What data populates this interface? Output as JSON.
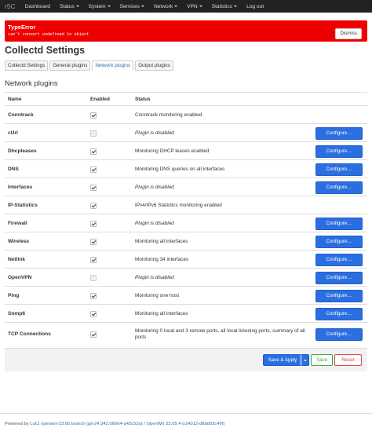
{
  "navbar": {
    "brand": "r5C",
    "items": [
      {
        "label": "Dashboard",
        "dropdown": false
      },
      {
        "label": "Status",
        "dropdown": true
      },
      {
        "label": "System",
        "dropdown": true
      },
      {
        "label": "Services",
        "dropdown": true
      },
      {
        "label": "Network",
        "dropdown": true
      },
      {
        "label": "VPN",
        "dropdown": true
      },
      {
        "label": "Statistics",
        "dropdown": true
      },
      {
        "label": "Log out",
        "dropdown": false
      }
    ]
  },
  "alert": {
    "title": "TypeError",
    "message": "can't convert undefined to object",
    "dismiss_label": "Dismiss",
    "color": "#ee0000"
  },
  "page": {
    "title": "Collectd Settings",
    "tabs": [
      {
        "label": "Collectd Settings",
        "active": false
      },
      {
        "label": "General plugins",
        "active": false
      },
      {
        "label": "Network plugins",
        "active": true
      },
      {
        "label": "Output plugins",
        "active": false
      }
    ],
    "section_title": "Network plugins"
  },
  "table": {
    "headers": {
      "name": "Name",
      "enabled": "Enabled",
      "status": "Status"
    },
    "configure_label": "Configure…",
    "rows": [
      {
        "name": "Conntrack",
        "enabled": true,
        "status": "Conntrack monitoring enabled",
        "disabled": false,
        "configure": false
      },
      {
        "name": "cUrl",
        "enabled": false,
        "status": "Plugin is disabled",
        "disabled": true,
        "configure": true
      },
      {
        "name": "Dhcpleases",
        "enabled": true,
        "status": "Monitoring DHCP leases enabled",
        "disabled": false,
        "configure": true
      },
      {
        "name": "DNS",
        "enabled": true,
        "status": "Monitoring DNS queries on all interfaces",
        "disabled": false,
        "configure": true
      },
      {
        "name": "Interfaces",
        "enabled": true,
        "status": "Plugin is disabled",
        "disabled": true,
        "configure": true
      },
      {
        "name": "IP-Statistics",
        "enabled": true,
        "status": "IPv4/IPv6 Statistics monitoring enabled",
        "disabled": false,
        "configure": false
      },
      {
        "name": "Firewall",
        "enabled": true,
        "status": "Plugin is disabled",
        "disabled": true,
        "configure": true
      },
      {
        "name": "Wireless",
        "enabled": true,
        "status": "Monitoring all interfaces",
        "disabled": false,
        "configure": true
      },
      {
        "name": "Netlink",
        "enabled": true,
        "status": "Monitoring 34 interfaces",
        "disabled": false,
        "configure": true
      },
      {
        "name": "OpenVPN",
        "enabled": false,
        "status": "Plugin is disabled",
        "disabled": true,
        "configure": true
      },
      {
        "name": "Ping",
        "enabled": true,
        "status": "Monitoring one host",
        "disabled": false,
        "configure": true
      },
      {
        "name": "Snmp6",
        "enabled": true,
        "status": "Monitoring all interfaces",
        "disabled": false,
        "configure": true
      },
      {
        "name": "TCP Connections",
        "enabled": true,
        "status": "Monitoring 0 local and 3 remote ports, all local listening ports, summary of all ports",
        "disabled": false,
        "configure": true
      }
    ]
  },
  "actions": {
    "save_apply": "Save & Apply",
    "save": "Save",
    "reset": "Reset"
  },
  "footer": {
    "prefix": "Powered by ",
    "luci_link": "LuCI openwrt-23.05 branch (git-24.342.06664-a42c53a)",
    "separator": " / ",
    "openwrt": "OpenWrt 23.05.4 (r24012-d8dd03c46f)"
  },
  "colors": {
    "navbar": "#222222",
    "primary": "#2b6ee0",
    "link": "#2b6cb5",
    "save": "#44aa44",
    "reset": "#dd4444"
  }
}
